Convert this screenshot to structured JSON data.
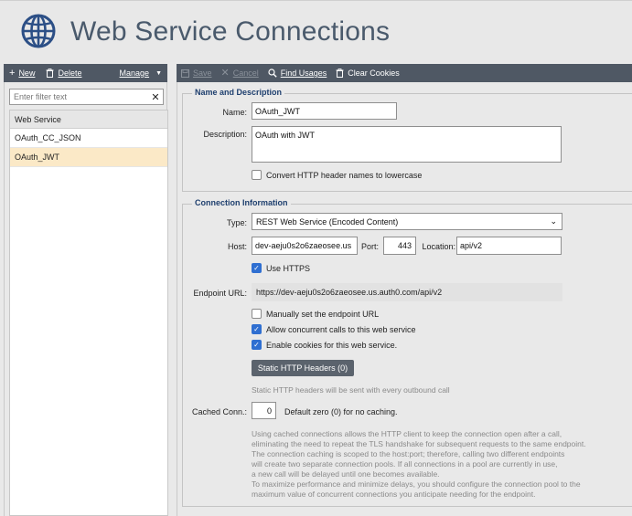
{
  "header": {
    "title": "Web Service Connections"
  },
  "left_toolbar": {
    "new_label": "New",
    "delete_label": "Delete",
    "manage_label": "Manage"
  },
  "filter": {
    "placeholder": "Enter filter text",
    "value": ""
  },
  "service_list": {
    "header": "Web Service",
    "items": [
      {
        "label": "OAuth_CC_JSON",
        "selected": false
      },
      {
        "label": "OAuth_JWT",
        "selected": true
      }
    ]
  },
  "right_toolbar": {
    "save_label": "Save",
    "cancel_label": "Cancel",
    "find_usages_label": "Find Usages",
    "clear_cookies_label": "Clear Cookies"
  },
  "name_section": {
    "title": "Name and Description",
    "name_label": "Name:",
    "name_value": "OAuth_JWT",
    "description_label": "Description:",
    "description_value": "OAuth with JWT",
    "lowercase_label": "Convert HTTP header names to lowercase",
    "lowercase_checked": false
  },
  "connection": {
    "title": "Connection Information",
    "type_label": "Type:",
    "type_value": "REST Web Service (Encoded Content)",
    "host_label": "Host:",
    "host_value": "dev-aeju0s2o6zaeosee.us",
    "port_label": "Port:",
    "port_value": "443",
    "location_label": "Location:",
    "location_value": "api/v2",
    "https_label": "Use HTTPS",
    "https_checked": true,
    "endpoint_label": "Endpoint URL:",
    "endpoint_value": "https://dev-aeju0s2o6zaeosee.us.auth0.com/api/v2",
    "manual_endpoint_label": "Manually set the endpoint URL",
    "manual_endpoint_checked": false,
    "concurrent_label": "Allow concurrent calls to this web service",
    "concurrent_checked": true,
    "cookies_label": "Enable cookies for this web service.",
    "cookies_checked": true,
    "static_headers_button": "Static HTTP Headers (0)",
    "static_headers_hint": "Static HTTP headers will be sent with every outbound call",
    "cached_conn_label": "Cached Conn.:",
    "cached_conn_value": "0",
    "cached_conn_note": "Default zero (0) for no caching.",
    "cache_help_lines": [
      "Using cached connections allows the HTTP client to keep the connection open after a call,",
      "eliminating the need to repeat the TLS handshake for subsequent requests to the same endpoint.",
      "The connection caching is scoped to the host:port; therefore, calling two different endpoints",
      "will create two separate connection pools. If all connections in a pool are currently in use,",
      "a new call will be delayed until one becomes available.",
      "To maximize performance and minimize delays, you should configure the connection pool to the",
      "maximum value of concurrent connections you anticipate needing for the endpoint."
    ]
  },
  "colors": {
    "toolbar_bg": "#4f5864",
    "section_title": "#1e3f6e",
    "selected_row": "#fbe9c7",
    "checkbox_on": "#2f6fd1",
    "title_text": "#4a5a6c"
  }
}
